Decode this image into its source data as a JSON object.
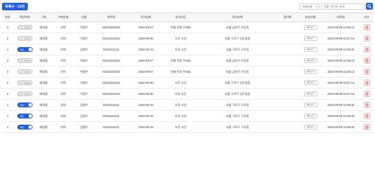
{
  "header": {
    "count_label": "목록수 : 10건",
    "filter_value": "거래유형",
    "search_placeholder": "이름, 연락처, 지역"
  },
  "columns": [
    "번호",
    "확인여부",
    "구분",
    "거래유형",
    "이름",
    "연락처",
    "투어일자",
    "투어시간",
    "투어지역",
    "협의록",
    "요청사항",
    "대화일",
    "비고"
  ],
  "rows": [
    {
      "no": "3",
      "confirmed": false,
      "toggle_text": "미확인",
      "status": "배정중",
      "type": "지역",
      "name": "박철수",
      "phone": "01033333333",
      "tour_date": "2024-09-07",
      "tour_time": "언제 전화 주세요",
      "region": "서울 금천구 가산동",
      "memo": "",
      "request": "내용 보기",
      "date": "2024-09-09 12:08:13",
      "delete": "삭제"
    },
    {
      "no": "2",
      "confirmed": false,
      "toggle_text": "미확인",
      "status": "배정중",
      "type": "지역",
      "name": "이철수",
      "phone": "01022222222",
      "tour_date": "2024-08-30",
      "tour_time": "오후 시간",
      "region": "서울 구로구 신도림동",
      "memo": "",
      "request": "내용 보기",
      "date": "2024-09-09 12:07:14",
      "delete": "삭제"
    },
    {
      "no": "1",
      "confirmed": true,
      "toggle_text": "확인",
      "status": "배정중",
      "type": "지역",
      "name": "김철수",
      "phone": "01011111111",
      "tour_date": "2024-09-15",
      "tour_time": "오전 시간",
      "region": "서울 구로구 구로동",
      "memo": "",
      "request": "내용 보기",
      "date": "2024-09-09 12:06:32",
      "delete": "삭제"
    },
    {
      "no": "3",
      "confirmed": false,
      "toggle_text": "미확인",
      "status": "배정중",
      "type": "지역",
      "name": "박철수",
      "phone": "01033333333",
      "tour_date": "2024-09-07",
      "tour_time": "언제 전화 주세요",
      "region": "서울 금천구 가산동",
      "memo": "",
      "request": "내용 보기",
      "date": "2024-09-09 12:08:13",
      "delete": "삭제"
    },
    {
      "no": "3",
      "confirmed": false,
      "toggle_text": "미확인",
      "status": "배정중",
      "type": "지역",
      "name": "박철수",
      "phone": "01033333333",
      "tour_date": "2024-09-07",
      "tour_time": "언제 전화 주세요",
      "region": "서울 금천구 가산동",
      "memo": "",
      "request": "내용 보기",
      "date": "2024-09-09 12:08:13",
      "delete": "삭제"
    },
    {
      "no": "2",
      "confirmed": false,
      "toggle_text": "미확인",
      "status": "배정중",
      "type": "지역",
      "name": "이철수",
      "phone": "01022222222",
      "tour_date": "2024-08-30",
      "tour_time": "오후 시간",
      "region": "서울 구로구 신도림동",
      "memo": "",
      "request": "내용 보기",
      "date": "2024-09-09 12:07:14",
      "delete": "삭제"
    },
    {
      "no": "2",
      "confirmed": false,
      "toggle_text": "미확인",
      "status": "배정중",
      "type": "지역",
      "name": "이철수",
      "phone": "01022222222",
      "tour_date": "2024-08-30",
      "tour_time": "오후 시간",
      "region": "서울 구로구 신도림동",
      "memo": "",
      "request": "내용 보기",
      "date": "2024-09-09 12:07:14",
      "delete": "삭제"
    },
    {
      "no": "1",
      "confirmed": true,
      "toggle_text": "확인",
      "status": "배정중",
      "type": "지역",
      "name": "김철수",
      "phone": "01011111111",
      "tour_date": "2024-09-15",
      "tour_time": "오전 시간",
      "region": "서울 구로구 구로동",
      "memo": "",
      "request": "내용 보기",
      "date": "2024-09-09 12:06:32",
      "delete": "삭제"
    },
    {
      "no": "1",
      "confirmed": true,
      "toggle_text": "확인",
      "status": "배정중",
      "type": "지역",
      "name": "김철수",
      "phone": "01011111111",
      "tour_date": "2024-09-15",
      "tour_time": "오전 시간",
      "region": "서울 구로구 구로동",
      "memo": "",
      "request": "내용 보기",
      "date": "2024-09-09 12:06:32",
      "delete": "삭제"
    },
    {
      "no": "1",
      "confirmed": true,
      "toggle_text": "확인",
      "status": "배정중",
      "type": "지역",
      "name": "김철수",
      "phone": "01011111111",
      "tour_date": "2024-09-15",
      "tour_time": "오전 시간",
      "region": "서울 구로구 구로동",
      "memo": "",
      "request": "내용 보기",
      "date": "2024-09-09 12:06:32",
      "delete": "삭제"
    }
  ],
  "icons": {
    "search": "search-icon",
    "filter_chevron": "chevron-down-icon",
    "delete": "trash-icon"
  },
  "colors": {
    "accent": "#1f5fe0",
    "status": "#e03c3c",
    "delete": "#e03c3c"
  }
}
